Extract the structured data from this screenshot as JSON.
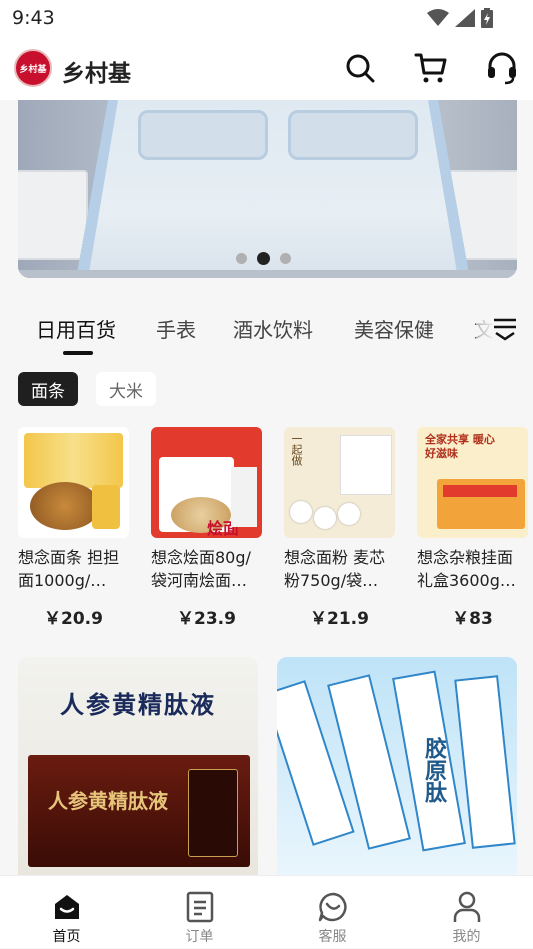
{
  "status_bar": {
    "time": "9:43"
  },
  "app_bar": {
    "logo_text": "乡村基",
    "title": "乡村基"
  },
  "banner": {
    "dots_total": 3,
    "active_dot": 2
  },
  "category_tabs": [
    "日用百货",
    "手表",
    "酒水饮料",
    "美容保健",
    "文"
  ],
  "sub_chips": [
    "面条",
    "大米"
  ],
  "products": [
    {
      "name": "想念面条 担担面1000g/…",
      "price": "￥20.9",
      "img_text": ""
    },
    {
      "name": "想念烩面80g/袋河南烩面…",
      "price": "￥23.9",
      "img_text": "烩面"
    },
    {
      "name": "想念面粉 麦芯粉750g/袋…",
      "price": "￥21.9",
      "img_text": "一起做"
    },
    {
      "name": "想念杂粮挂面礼盒3600g…",
      "price": "￥83",
      "img_text": "全家共享 暖心好滋味"
    }
  ],
  "feed": [
    {
      "title": "人参黄精肽液",
      "box_text": "人参黄精肽液"
    },
    {
      "title": "胶原肽"
    }
  ],
  "bottom_nav": [
    {
      "label": "首页",
      "icon": "home-icon",
      "active": true
    },
    {
      "label": "订单",
      "icon": "order-icon",
      "active": false
    },
    {
      "label": "客服",
      "icon": "chat-icon",
      "active": false
    },
    {
      "label": "我的",
      "icon": "profile-icon",
      "active": false
    }
  ]
}
